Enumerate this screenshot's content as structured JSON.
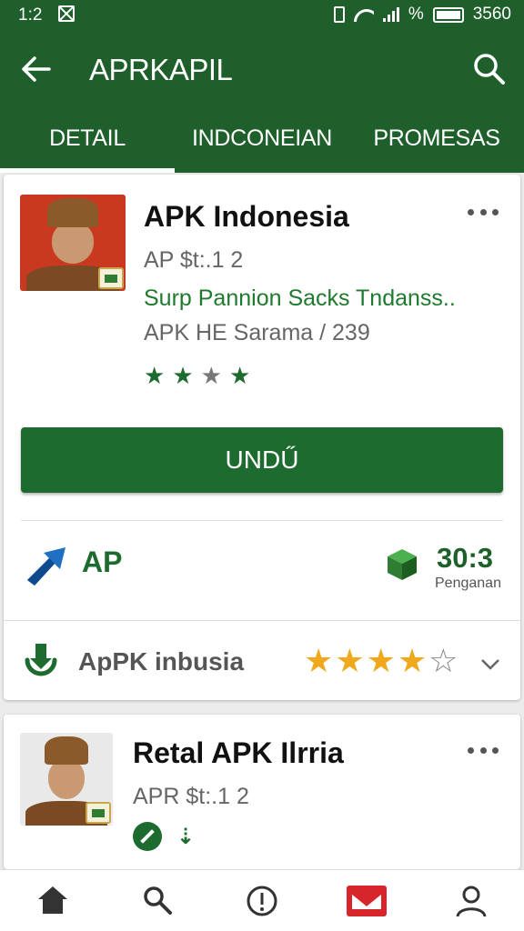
{
  "status_bar": {
    "time": "1:2",
    "battery_text": "%",
    "clock_right": "3560"
  },
  "header": {
    "title": "APRKAPIL"
  },
  "tabs": [
    {
      "label": "DETAIL",
      "active": true
    },
    {
      "label": "INDCONEIAN",
      "active": false
    },
    {
      "label": "PROMESAS",
      "active": false
    }
  ],
  "card1": {
    "name": "APK Indonesia",
    "version": "AP $t:.1 2",
    "tagline": "Surp Pannion Sacks Tndanss..",
    "developer": "APK HE Sarama / 239",
    "stars_filled": 4,
    "stars_total": 5,
    "install_label": "UNDŰ",
    "stat_label": "AP",
    "stat_value": "30:3",
    "stat_sub": "Penganan",
    "review_label": "ApPK inbusia",
    "rating": 4,
    "rating_total": 5
  },
  "card2": {
    "name": "Retal APK Ilrria",
    "version": "APR $t:.1 2"
  },
  "colors": {
    "primary": "#1e5f2b",
    "accent_green": "#1e6b30",
    "star_gold": "#f0a81c",
    "notif_red": "#d7262b"
  },
  "bottom_nav": [
    {
      "icon": "home-icon"
    },
    {
      "icon": "search-icon"
    },
    {
      "icon": "info-icon"
    },
    {
      "icon": "mail-icon"
    },
    {
      "icon": "profile-icon"
    }
  ]
}
